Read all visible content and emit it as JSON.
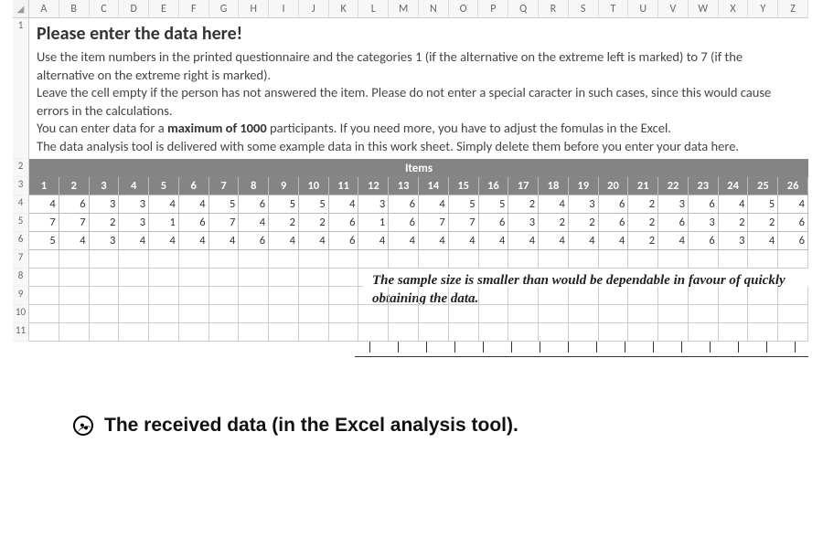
{
  "columns": [
    "A",
    "B",
    "C",
    "D",
    "E",
    "F",
    "G",
    "H",
    "I",
    "J",
    "K",
    "L",
    "M",
    "N",
    "O",
    "P",
    "Q",
    "R",
    "S",
    "T",
    "U",
    "V",
    "W",
    "X",
    "Y",
    "Z"
  ],
  "row_numbers": [
    1,
    2,
    3,
    4,
    5,
    6,
    7,
    8,
    9,
    10,
    11
  ],
  "instructions": {
    "title": "Please enter the data here!",
    "p1a": "Use the item numbers in the printed questionnaire and the categories 1 (if the alternative on the extreme left is marked) to 7 (if the alternative on the extreme right is marked).",
    "p2": "Leave the cell empty if the person has not answered the item. Please do not enter a special caracter in such cases, since this would cause errors in the calculations.",
    "p3a": "You can enter data for a ",
    "p3b": "maximum of 1000",
    "p3c": " participants. If you need more, you have to adjust the fomulas in the Excel.",
    "p4": "The data analysis tool is delivered with some example data in this work sheet. Simply delete them before you enter your data here."
  },
  "items_label": "Items",
  "chart_data": {
    "type": "table",
    "title": "Items",
    "columns": [
      1,
      2,
      3,
      4,
      5,
      6,
      7,
      8,
      9,
      10,
      11,
      12,
      13,
      14,
      15,
      16,
      17,
      18,
      19,
      20,
      21,
      22,
      23,
      24,
      25,
      26
    ],
    "rows": [
      [
        4,
        6,
        3,
        3,
        4,
        4,
        5,
        6,
        5,
        5,
        4,
        3,
        6,
        4,
        5,
        5,
        2,
        4,
        3,
        6,
        2,
        3,
        6,
        4,
        5,
        4
      ],
      [
        7,
        7,
        2,
        3,
        1,
        6,
        7,
        4,
        2,
        2,
        6,
        1,
        6,
        7,
        7,
        6,
        3,
        2,
        2,
        6,
        2,
        6,
        3,
        2,
        2,
        6
      ],
      [
        5,
        4,
        3,
        4,
        4,
        4,
        4,
        6,
        4,
        4,
        6,
        4,
        4,
        4,
        4,
        4,
        4,
        4,
        4,
        4,
        2,
        4,
        6,
        3,
        4,
        6
      ]
    ],
    "xlabel": "",
    "ylabel": ""
  },
  "note_text": "The sample size is smaller than would be dependable in favour of quickly obtaining the data.",
  "caption_icon": "yin-yang-icon",
  "caption": "The received data (in the Excel analysis tool)."
}
